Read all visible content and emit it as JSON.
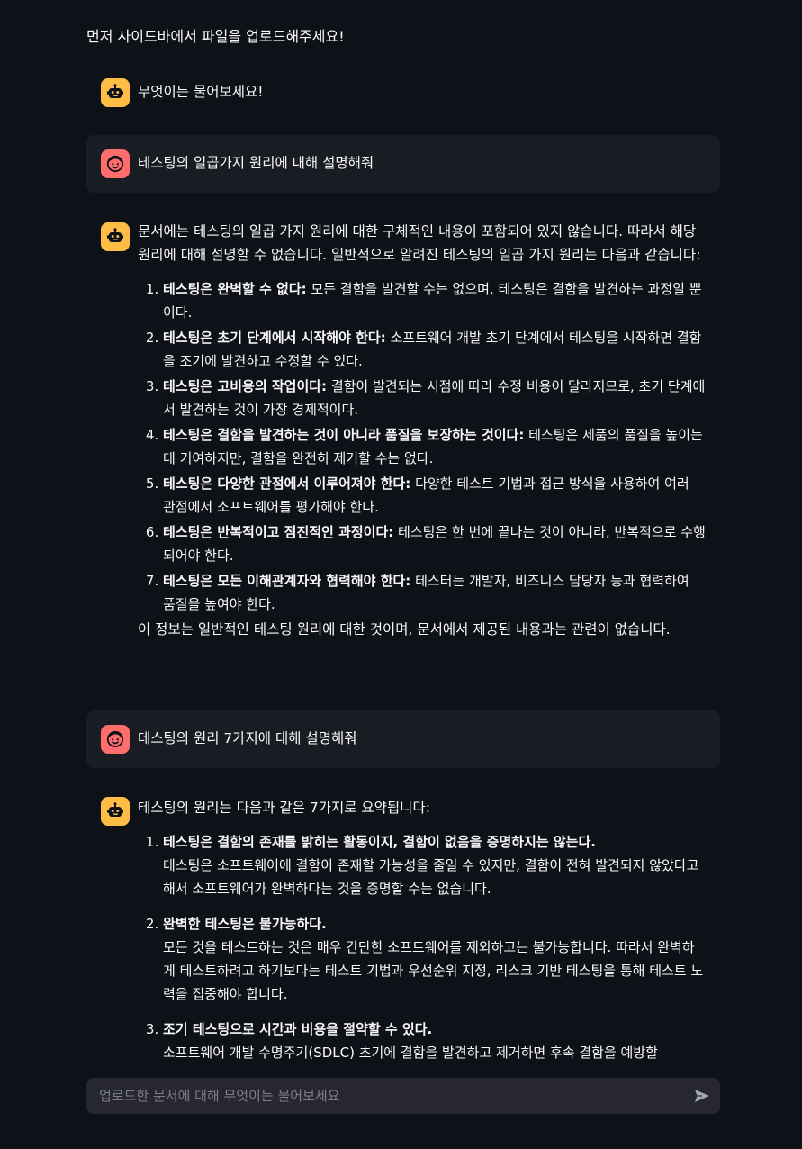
{
  "notice": "먼저 사이드바에서 파일을 업로드해주세요!",
  "messages": [
    {
      "role": "assistant",
      "text": "무엇이든 물어보세요!"
    },
    {
      "role": "user",
      "text": "테스팅의 일곱가지 원리에 대해 설명해줘"
    },
    {
      "role": "assistant",
      "intro": "문서에는 테스팅의 일곱 가지 원리에 대한 구체적인 내용이 포함되어 있지 않습니다. 따라서 해당 원리에 대해 설명할 수 없습니다. 일반적으로 알려진 테스팅의 일곱 가지 원리는 다음과 같습니다:",
      "items": [
        {
          "num": "1.",
          "title": "테스팅은 완벽할 수 없다:",
          "desc": " 모든 결함을 발견할 수는 없으며, 테스팅은 결함을 발견하는 과정일 뿐이다."
        },
        {
          "num": "2.",
          "title": "테스팅은 초기 단계에서 시작해야 한다:",
          "desc": " 소프트웨어 개발 초기 단계에서 테스팅을 시작하면 결함을 조기에 발견하고 수정할 수 있다."
        },
        {
          "num": "3.",
          "title": "테스팅은 고비용의 작업이다:",
          "desc": " 결함이 발견되는 시점에 따라 수정 비용이 달라지므로, 초기 단계에서 발견하는 것이 가장 경제적이다."
        },
        {
          "num": "4.",
          "title": "테스팅은 결함을 발견하는 것이 아니라 품질을 보장하는 것이다:",
          "desc": " 테스팅은 제품의 품질을 높이는 데 기여하지만, 결함을 완전히 제거할 수는 없다."
        },
        {
          "num": "5.",
          "title": "테스팅은 다양한 관점에서 이루어져야 한다:",
          "desc": " 다양한 테스트 기법과 접근 방식을 사용하여 여러 관점에서 소프트웨어를 평가해야 한다."
        },
        {
          "num": "6.",
          "title": "테스팅은 반복적이고 점진적인 과정이다:",
          "desc": " 테스팅은 한 번에 끝나는 것이 아니라, 반복적으로 수행되어야 한다."
        },
        {
          "num": "7.",
          "title": "테스팅은 모든 이해관계자와 협력해야 한다:",
          "desc": " 테스터는 개발자, 비즈니스 담당자 등과 협력하여 품질을 높여야 한다."
        }
      ],
      "closing": "이 정보는 일반적인 테스팅 원리에 대한 것이며, 문서에서 제공된 내용과는 관련이 없습니다."
    },
    {
      "role": "user",
      "text": "테스팅의 원리 7가지에 대해 설명해줘"
    },
    {
      "role": "assistant",
      "intro": "테스팅의 원리는 다음과 같은 7가지로 요약됩니다:",
      "items": [
        {
          "num": "1.",
          "title": "테스팅은 결함의 존재를 밝히는 활동이지, 결함이 없음을 증명하지는 않는다.",
          "desc": "테스팅은 소프트웨어에 결함이 존재할 가능성을 줄일 수 있지만, 결함이 전혀 발견되지 않았다고 해서 소프트웨어가 완벽하다는 것을 증명할 수는 없습니다."
        },
        {
          "num": "2.",
          "title": "완벽한 테스팅은 불가능하다.",
          "desc": "모든 것을 테스트하는 것은 매우 간단한 소프트웨어를 제외하고는 불가능합니다. 따라서 완벽하게 테스트하려고 하기보다는 테스트 기법과 우선순위 지정, 리스크 기반 테스팅을 통해 테스트 노력을 집중해야 합니다."
        },
        {
          "num": "3.",
          "title": "조기 테스팅으로 시간과 비용을 절약할 수 있다.",
          "desc": "소프트웨어 개발 수명주기(SDLC) 초기에 결함을 발견하고 제거하면 후속 결함을 예방할"
        }
      ]
    }
  ],
  "chat_input": {
    "placeholder": "업로드한 문서에 대해 무엇이든 물어보세요"
  },
  "icons": {
    "assistant_avatar": "robot-icon",
    "user_avatar": "smiley-face-icon",
    "send": "send-arrow-icon"
  },
  "colors": {
    "background": "#0e1117",
    "user_message_bg": "#1a1c24",
    "assistant_avatar": "#ffbd45",
    "user_avatar": "#ff6c6c",
    "input_bg": "#262730"
  }
}
